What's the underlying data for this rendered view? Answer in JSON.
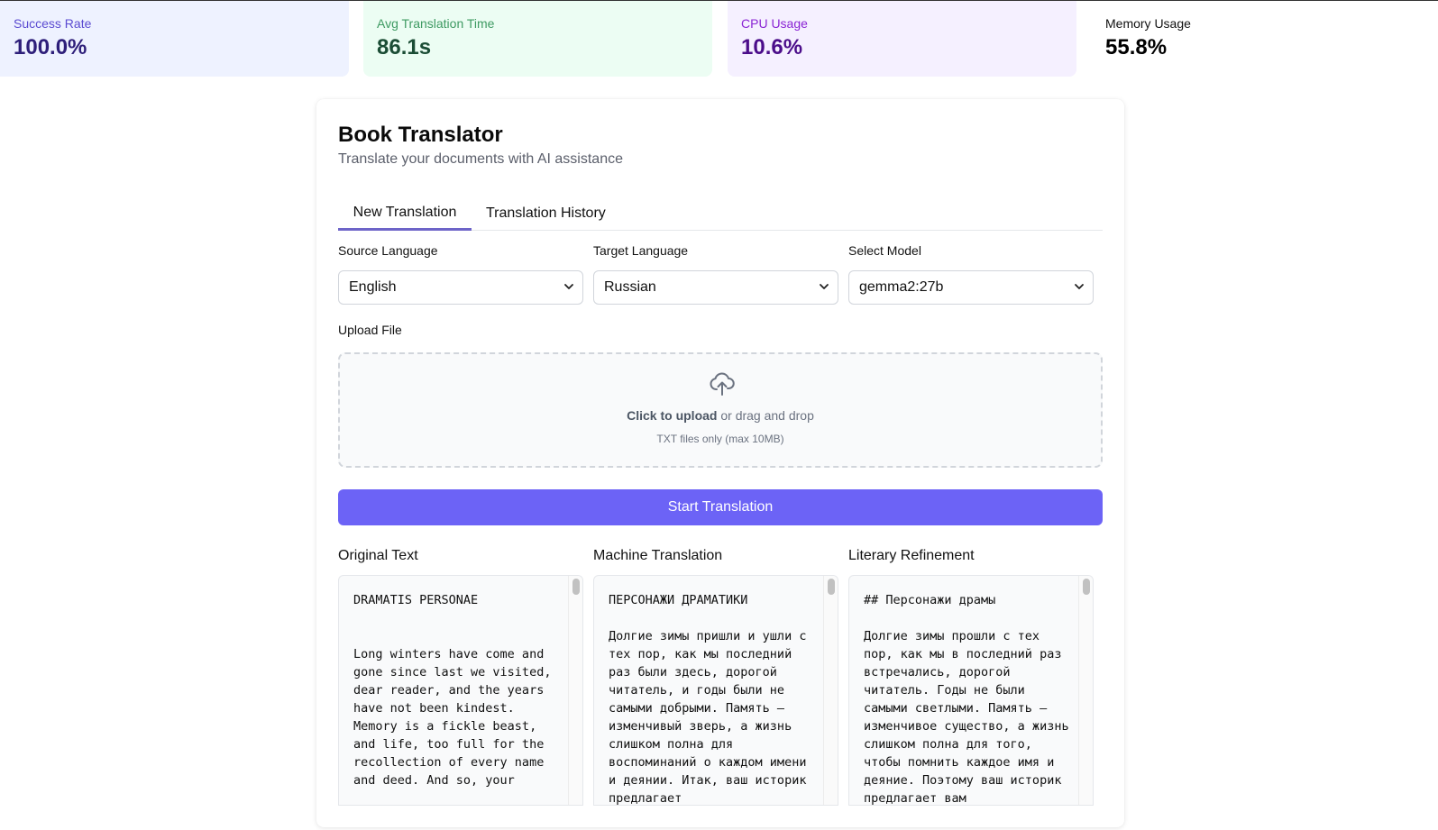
{
  "stats": [
    {
      "label": "Success Rate",
      "value": "100.0%"
    },
    {
      "label": "Avg Translation Time",
      "value": "86.1s"
    },
    {
      "label": "CPU Usage",
      "value": "10.6%"
    },
    {
      "label": "Memory Usage",
      "value": "55.8%"
    }
  ],
  "header": {
    "title": "Book Translator",
    "subtitle": "Translate your documents with AI assistance"
  },
  "tabs": [
    {
      "label": "New Translation",
      "active": true
    },
    {
      "label": "Translation History",
      "active": false
    }
  ],
  "form": {
    "source_language": {
      "label": "Source Language",
      "value": "English"
    },
    "target_language": {
      "label": "Target Language",
      "value": "Russian"
    },
    "model": {
      "label": "Select Model",
      "value": "gemma2:27b"
    },
    "upload": {
      "label": "Upload File",
      "click_text": "Click to upload",
      "drag_text": " or drag and drop",
      "hint": "TXT files only (max 10MB)",
      "icon": "cloud-upload-icon"
    },
    "start_button": "Start Translation"
  },
  "results": {
    "original": {
      "title": "Original Text",
      "text": "DRAMATIS PERSONAE\n\n\nLong winters have come and gone since last we visited, dear reader, and the years have not been kindest. Memory is a fickle beast, and life, too full for the recollection of every name and deed. And so, your"
    },
    "machine": {
      "title": "Machine Translation",
      "text": "ПЕРСОНАЖИ ДРАМАТИКИ\n\nДолгие зимы пришли и ушли с тех пор, как мы последний раз были здесь, дорогой читатель, и годы были не самыми добрыми. Память — изменчивый зверь, а жизнь слишком полна для воспоминаний о каждом имени и деянии. Итак, ваш историк предлагает"
    },
    "literary": {
      "title": "Literary Refinement",
      "text": "## Персонажи драмы\n\nДолгие зимы прошли с тех пор, как мы в последний раз встречались, дорогой читатель. Годы не были самыми светлыми. Память — изменчивое существо, а жизнь слишком полна для того, чтобы помнить каждое имя и деяние. Поэтому ваш историк предлагает вам"
    }
  },
  "colors": {
    "accent": "#6c63f6",
    "tab_underline": "#6d64c8"
  }
}
